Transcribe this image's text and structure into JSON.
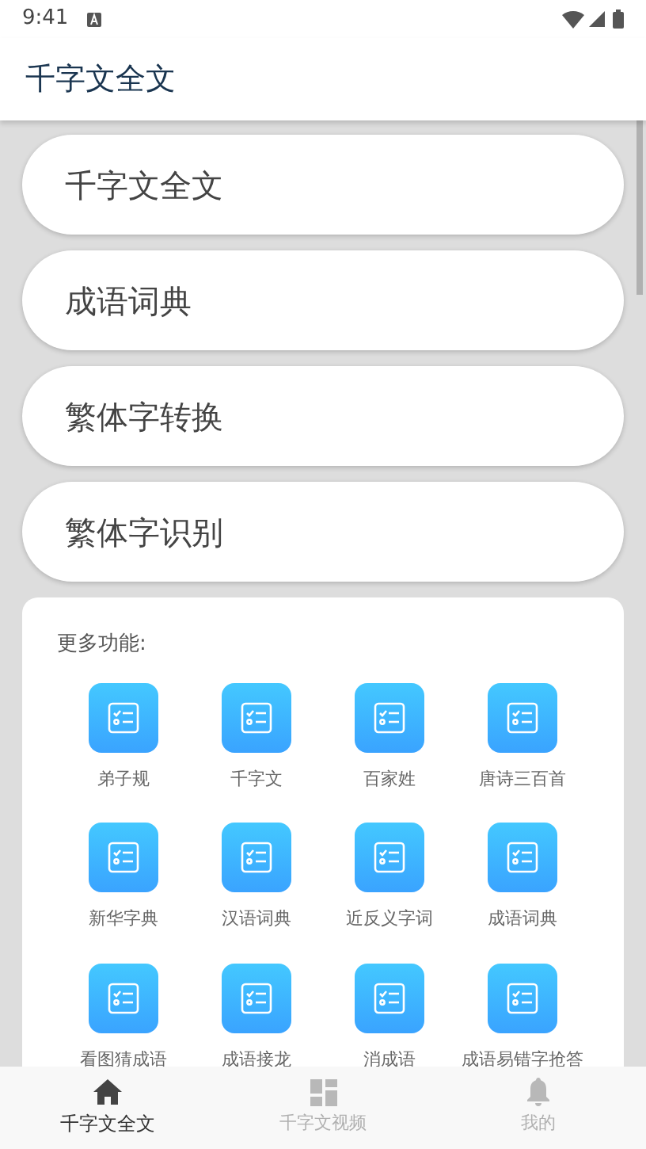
{
  "status_bar": {
    "time": "9:41"
  },
  "app_bar": {
    "title": "千字文全文"
  },
  "menu_buttons": [
    {
      "label": "千字文全文"
    },
    {
      "label": "成语词典"
    },
    {
      "label": "繁体字转换"
    },
    {
      "label": "繁体字识别"
    }
  ],
  "more": {
    "title": "更多功能:",
    "items": [
      {
        "label": "弟子规"
      },
      {
        "label": "千字文"
      },
      {
        "label": "百家姓"
      },
      {
        "label": "唐诗三百首"
      },
      {
        "label": "新华字典"
      },
      {
        "label": "汉语词典"
      },
      {
        "label": "近反义字词"
      },
      {
        "label": "成语词典"
      },
      {
        "label": "看图猜成语"
      },
      {
        "label": "成语接龙"
      },
      {
        "label": "消成语"
      },
      {
        "label": "成语易错字抢答"
      }
    ]
  },
  "tabs": [
    {
      "label": "千字文全文",
      "kind": "home",
      "selected": true
    },
    {
      "label": "千字文视频",
      "kind": "grid",
      "selected": false
    },
    {
      "label": "我的",
      "kind": "bell",
      "selected": false
    }
  ]
}
